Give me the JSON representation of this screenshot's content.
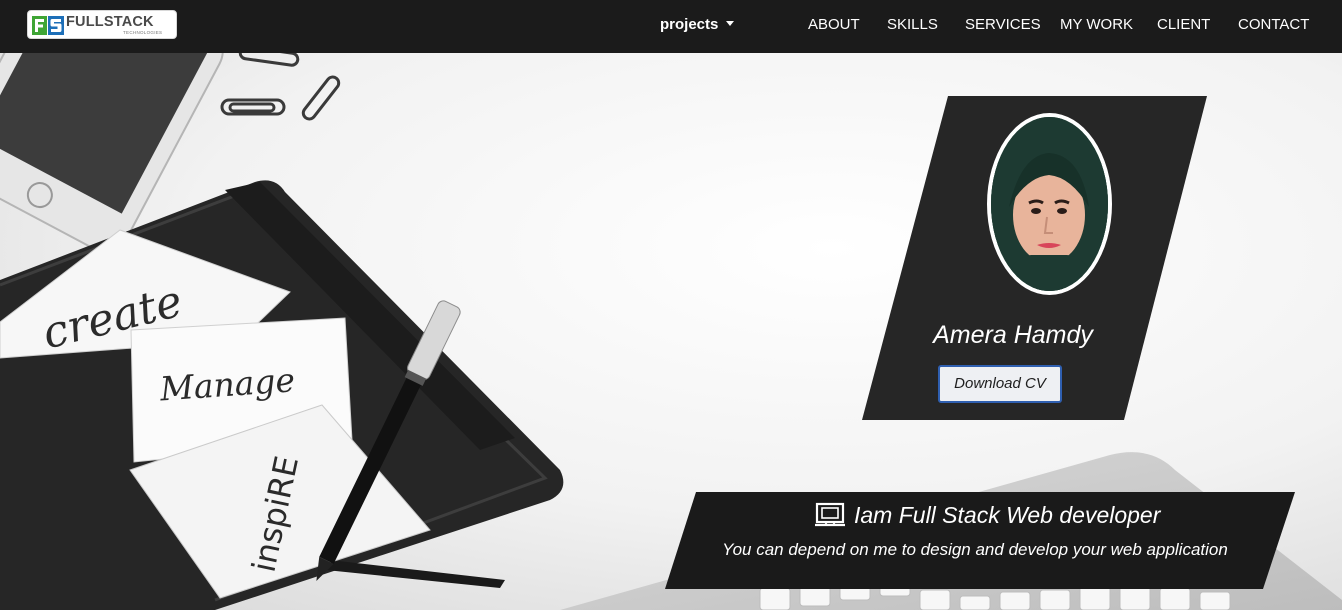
{
  "brand": {
    "name": "FULLSTACK",
    "tagline": "TECHNOLOGIES",
    "mark_letters": "FS",
    "mark_colors": [
      "#3fa535",
      "#1d6fb8"
    ]
  },
  "nav": {
    "dropdown": {
      "label": "projects",
      "icon": "caret-down-icon"
    },
    "links": [
      "ABOUT",
      "SKILLS",
      "SERVICES",
      "MY WORK",
      "CLIENT",
      "CONTACT"
    ]
  },
  "hero": {
    "background": "grayscale desk photo",
    "doodle_words": [
      "create",
      "Manage",
      "inspiRE"
    ]
  },
  "profile": {
    "name": "Amera Hamdy",
    "download_label": "Download CV",
    "button_border_color": "#2f5fb0",
    "card_color": "#262626"
  },
  "banner": {
    "icon": "monitor-code-icon",
    "title": "Iam Full Stack Web developer",
    "subtitle": "You can depend on me to design and develop your web application",
    "color": "#1a1a1a"
  }
}
